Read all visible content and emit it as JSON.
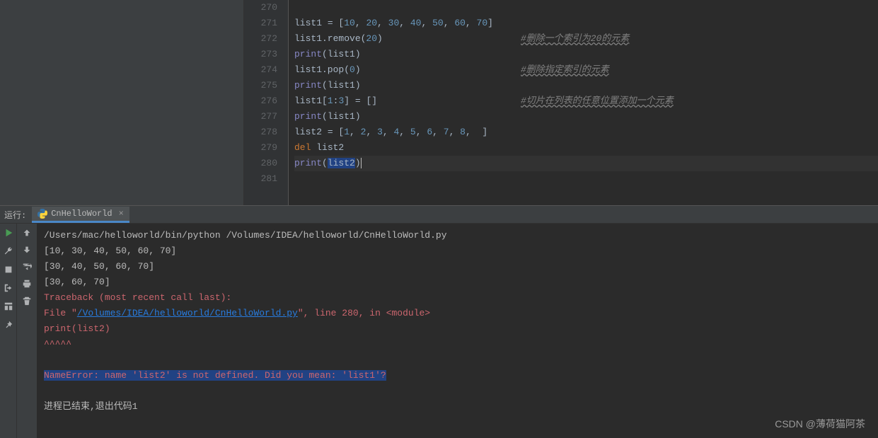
{
  "lines": {
    "start": 270,
    "end": 281
  },
  "code": {
    "l271": {
      "var": "list1",
      "vals": [
        "10",
        "20",
        "30",
        "40",
        "50",
        "60",
        "70"
      ]
    },
    "l272": {
      "text": "list1.remove(",
      "arg": "20",
      "comment": "#删除一个索引为20的元素"
    },
    "l273": {
      "fn": "print",
      "arg": "list1"
    },
    "l274": {
      "text": "list1.pop(",
      "arg": "0",
      "comment": "#删除指定索引的元素"
    },
    "l275": {
      "fn": "print",
      "arg": "list1"
    },
    "l276": {
      "text": "list1[",
      "s1": "1",
      "s2": "3",
      "comment": "#切片在列表的任意位置添加一个元素"
    },
    "l277": {
      "fn": "print",
      "arg": "list1"
    },
    "l278": {
      "var": "list2",
      "vals": [
        "1",
        "2",
        "3",
        "4",
        "5",
        "6",
        "7",
        "8"
      ]
    },
    "l279": {
      "kw": "del",
      "arg": "list2"
    },
    "l280": {
      "fn": "print",
      "arg": "list2"
    }
  },
  "run": {
    "label": "运行:",
    "tab": "CnHelloWorld"
  },
  "console": {
    "cmd": "/Users/mac/helloworld/bin/python /Volumes/IDEA/helloworld/CnHelloWorld.py",
    "out1": "[10, 30, 40, 50, 60, 70]",
    "out2": "[30, 40, 50, 60, 70]",
    "out3": "[30, 60, 70]",
    "trace": "Traceback (most recent call last):",
    "file_pre": "  File \"",
    "file_link": "/Volumes/IDEA/helloworld/CnHelloWorld.py",
    "file_post": "\", line 280, in <module>",
    "err_line": "    print(list2)",
    "caret_line": "          ^^^^^",
    "name_err": "NameError: name 'list2' is not defined. Did you mean: 'list1'?",
    "exit": "进程已结束,退出代码1"
  },
  "watermark": "CSDN @薄荷猫阿茶"
}
